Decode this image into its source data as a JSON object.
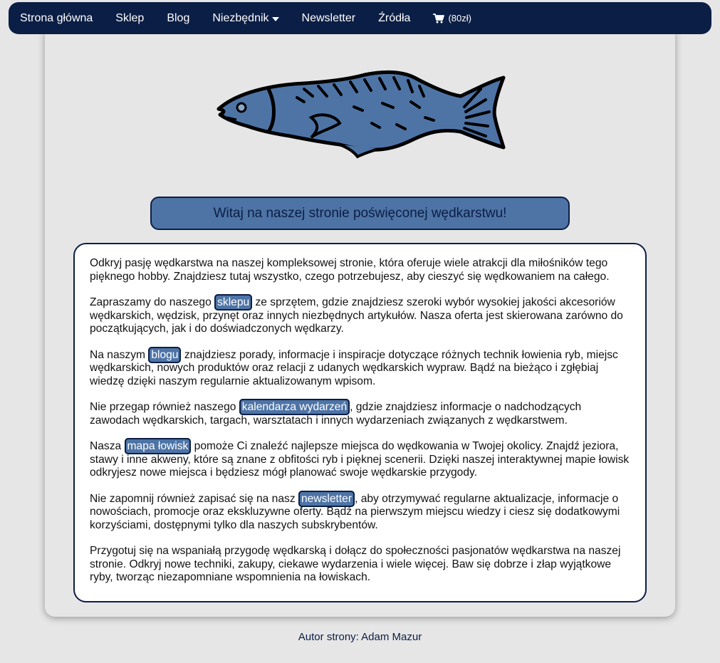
{
  "nav": {
    "items": [
      "Strona główna",
      "Sklep",
      "Blog",
      "Niezbędnik",
      "Newsletter",
      "Źródła"
    ],
    "cart_label": "(80zł)"
  },
  "hero": {
    "title": "Witaj na naszej stronie poświęconej wędkarstwu!"
  },
  "content": {
    "p1": "Odkryj pasję wędkarstwa na naszej kompleksowej stronie, która oferuje wiele atrakcji dla miłośników tego pięknego hobby. Znajdziesz tutaj wszystko, czego potrzebujesz, aby cieszyć się wędkowaniem na całego.",
    "p2_before": "Zapraszamy do naszego ",
    "p2_link": "sklepu",
    "p2_after": " ze sprzętem, gdzie znajdziesz szeroki wybór wysokiej jakości akcesoriów wędkarskich, wędzisk, przynęt oraz innych niezbędnych artykułów. Nasza oferta jest skierowana zarówno do początkujących, jak i do doświadczonych wędkarzy.",
    "p3_before": "Na naszym ",
    "p3_link": "blogu",
    "p3_after": " znajdziesz porady, informacje i inspiracje dotyczące różnych technik łowienia ryb, miejsc wędkarskich, nowych produktów oraz relacji z udanych wędkarskich wypraw. Bądź na bieżąco i zgłębiaj wiedzę dzięki naszym regularnie aktualizowanym wpisom.",
    "p4_before": "Nie przegap również naszego ",
    "p4_link": "kalendarza wydarzeń",
    "p4_after": ", gdzie znajdziesz informacje o nadchodzących zawodach wędkarskich, targach, warsztatach i innych wydarzeniach związanych z wędkarstwem.",
    "p5_before": "Nasza ",
    "p5_link": "mapa łowisk",
    "p5_after": " pomoże Ci znaleźć najlepsze miejsca do wędkowania w Twojej okolicy. Znajdź jeziora, stawy i inne akweny, które są znane z obfitości ryb i pięknej scenerii. Dzięki naszej interaktywnej mapie łowisk odkryjesz nowe miejsca i będziesz mógł planować swoje wędkarskie przygody.",
    "p6_before": "Nie zapomnij również zapisać się na nasz ",
    "p6_link": "newsletter",
    "p6_after": ", aby otrzymywać regularne aktualizacje, informacje o nowościach, promocje oraz ekskluzywne oferty. Bądź na pierwszym miejscu wiedzy i ciesz się dodatkowymi korzyściami, dostępnymi tylko dla naszych subskrybentów.",
    "p7": "Przygotuj się na wspaniałą przygodę wędkarską i dołącz do społeczności pasjonatów wędkarstwa na naszej stronie. Odkryj nowe techniki, zakupy, ciekawe wydarzenia i wiele więcej. Baw się dobrze i złap wyjątkowe ryby, tworząc niezapomniane wspomnienia na łowiskach."
  },
  "footer": {
    "text": "Autor strony: Adam Mazur"
  },
  "colors": {
    "navy": "#0b1e45",
    "accent": "#4e74a6",
    "background": "#e6e6e6"
  },
  "icons": {
    "logo": "fish-icon",
    "cart": "cart-icon",
    "dropdown": "caret-down-icon"
  }
}
